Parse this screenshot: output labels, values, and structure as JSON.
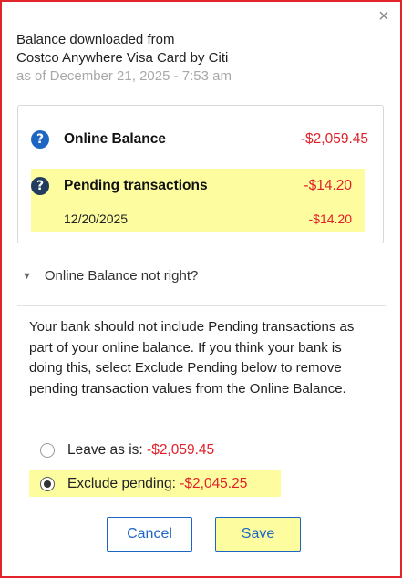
{
  "dialog": {
    "close_glyph": "×",
    "header": {
      "line1": "Balance downloaded from",
      "line2": "Costco Anywhere Visa Card by Citi",
      "line3": "as of December 21, 2025 - 7:53 am"
    },
    "balances": {
      "online": {
        "label": "Online Balance",
        "value": "-$2,059.45"
      },
      "pending": {
        "label": "Pending transactions",
        "value": "-$14.20",
        "items": [
          {
            "date": "12/20/2025",
            "amount": "-$14.20"
          }
        ]
      }
    },
    "toggle": {
      "label": "Online Balance not right?"
    },
    "explanation": "Your bank should not include Pending transactions as part of your online balance. If you think your bank is doing this, select Exclude Pending below to remove pending transaction values from the Online Balance.",
    "options": [
      {
        "label": "Leave as is:",
        "value": "-$2,059.45",
        "selected": false
      },
      {
        "label": "Exclude pending:",
        "value": "-$2,045.25",
        "selected": true
      }
    ],
    "buttons": {
      "cancel": "Cancel",
      "save": "Save"
    }
  },
  "colors": {
    "frame_border": "#e0242a",
    "negative": "#e0202a",
    "highlight": "#fdfda0",
    "button_blue": "#1e66c4",
    "icon_blue": "#1f66c3",
    "icon_dark": "#213c5c"
  },
  "icons": {
    "close": "close-icon",
    "online_help": "question-circle-icon",
    "pending_help": "question-circle-icon",
    "toggle": "triangle-down-icon"
  }
}
